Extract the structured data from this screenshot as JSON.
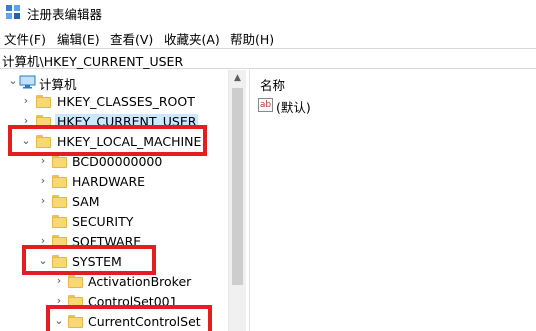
{
  "window": {
    "title": "注册表编辑器"
  },
  "menu": [
    "文件(F)",
    "编辑(E)",
    "查看(V)",
    "收藏夹(A)",
    "帮助(H)"
  ],
  "address": "计算机\\HKEY_CURRENT_USER",
  "tree": [
    {
      "label": "计算机",
      "chevron": "down",
      "icon": "computer-icon"
    },
    {
      "label": "HKEY_CLASSES_ROOT",
      "chevron": "right",
      "icon": "folder-icon"
    },
    {
      "label": "HKEY_CURRENT_USER",
      "chevron": "right",
      "icon": "folder-icon",
      "selected": true
    },
    {
      "label": "HKEY_LOCAL_MACHINE",
      "chevron": "down",
      "icon": "folder-icon"
    },
    {
      "label": "BCD00000000",
      "chevron": "right",
      "icon": "folder-icon"
    },
    {
      "label": "HARDWARE",
      "chevron": "right",
      "icon": "folder-icon"
    },
    {
      "label": "SAM",
      "chevron": "right",
      "icon": "folder-icon"
    },
    {
      "label": "SECURITY",
      "chevron": "none",
      "icon": "folder-icon"
    },
    {
      "label": "SOFTWARE",
      "chevron": "right",
      "icon": "folder-icon"
    },
    {
      "label": "SYSTEM",
      "chevron": "down",
      "icon": "folder-icon"
    },
    {
      "label": "ActivationBroker",
      "chevron": "right",
      "icon": "folder-icon"
    },
    {
      "label": "ControlSet001",
      "chevron": "right",
      "icon": "folder-icon"
    },
    {
      "label": "CurrentControlSet",
      "chevron": "down",
      "icon": "folder-icon"
    }
  ],
  "list": {
    "column_name": "名称",
    "values": [
      {
        "name": "(默认)",
        "icon": "string-value-icon"
      }
    ]
  },
  "colors": {
    "highlight_border": "#e41c23",
    "selection": "#cce8ff",
    "folder": "#f8d775"
  }
}
